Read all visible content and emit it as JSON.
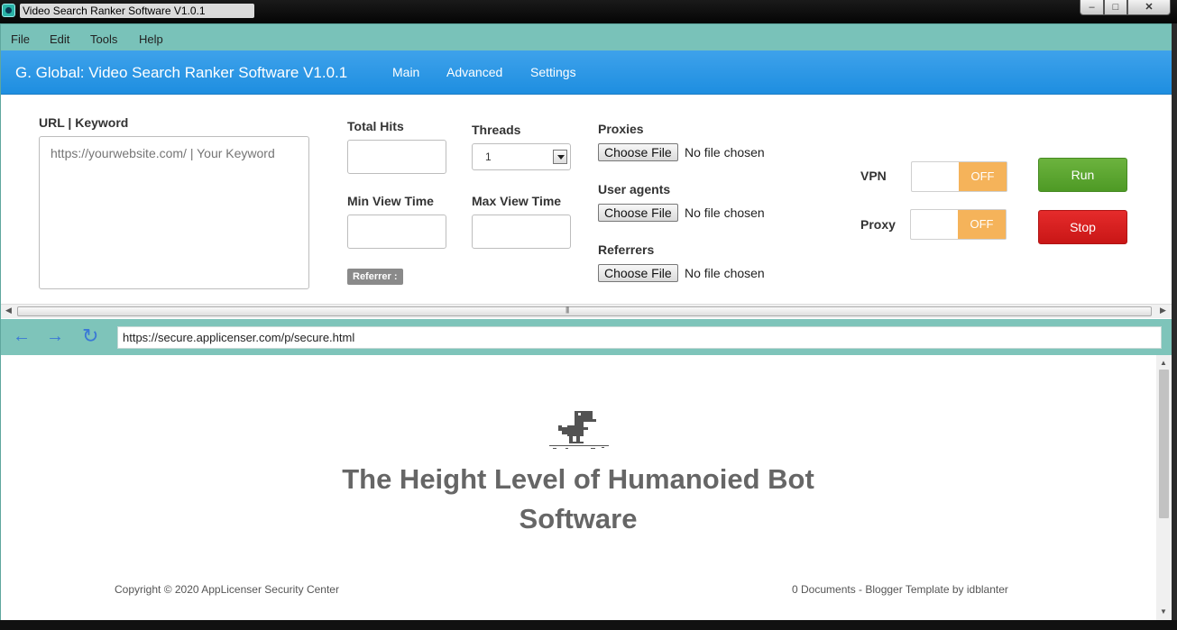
{
  "window": {
    "title": "Video Search Ranker Software V1.0.1"
  },
  "menu": [
    "File",
    "Edit",
    "Tools",
    "Help"
  ],
  "header": {
    "brand": "G. Global: Video Search Ranker Software V1.0.1",
    "nav": [
      "Main",
      "Advanced",
      "Settings"
    ]
  },
  "form": {
    "url_label": "URL | Keyword",
    "url_placeholder": "https://yourwebsite.com/ | Your Keyword",
    "total_hits_label": "Total Hits",
    "total_hits_value": "",
    "threads_label": "Threads",
    "threads_value": "1",
    "min_view_label": "Min View Time",
    "min_view_value": "",
    "max_view_label": "Max View Time",
    "max_view_value": "",
    "referrer_badge": "Referrer :",
    "proxies_label": "Proxies",
    "user_agents_label": "User agents",
    "referrers_label": "Referrers",
    "choose_file": "Choose File",
    "no_file": "No file chosen",
    "vpn_label": "VPN",
    "proxy_label": "Proxy",
    "toggle_off": "OFF",
    "run_label": "Run",
    "stop_label": "Stop"
  },
  "browser": {
    "url": "https://secure.applicenser.com/p/secure.html"
  },
  "web": {
    "headline_line1": "The Height Level of Humanoied Bot",
    "headline_line2": "Software",
    "footer_left": "Copyright © 2020 AppLicenser Security Center",
    "footer_right": "0 Documents - Blogger Template by idblanter"
  },
  "colors": {
    "menubar": "#79c2b9",
    "header": "#2a97e6",
    "run": "#5ba52f",
    "stop": "#d61f1f",
    "toggle_off": "#f5b35a"
  }
}
